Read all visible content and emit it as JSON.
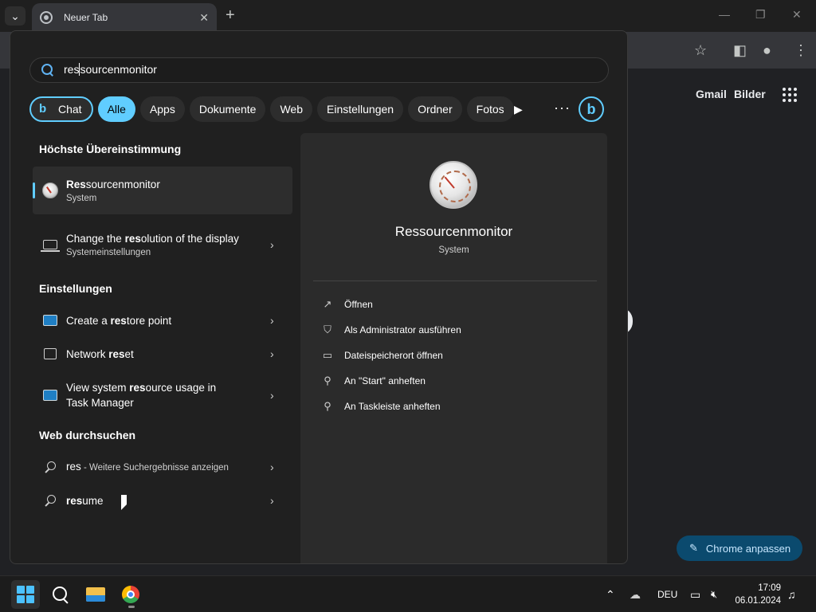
{
  "browser": {
    "tab_title": "Neuer Tab",
    "tab_close": "✕",
    "new_tab": "+",
    "tab_search": "⌄",
    "window_controls": {
      "minimize": "—",
      "maximize": "❐",
      "close": "✕"
    },
    "toolbar_icons": {
      "bookmark": "☆",
      "side_panel": "◧",
      "profile": "●",
      "menu": "⋮"
    },
    "gbar": {
      "gmail": "Gmail",
      "images": "Bilder"
    },
    "customize_button": "Chrome anpassen",
    "customize_icon": "✎"
  },
  "search": {
    "query_prefix": "res",
    "query_rest": "sourcenmonitor",
    "filters": [
      {
        "label": "Chat",
        "icon": "b"
      },
      {
        "label": "Alle",
        "active": true
      },
      {
        "label": "Apps"
      },
      {
        "label": "Dokumente"
      },
      {
        "label": "Web"
      },
      {
        "label": "Einstellungen"
      },
      {
        "label": "Ordner"
      },
      {
        "label": "Fotos"
      }
    ],
    "more_play": "▶",
    "more_dots": "···",
    "bing_icon": "b"
  },
  "results": {
    "best_match_title": "Höchste Übereinstimmung",
    "best_match": [
      {
        "bold": "Res",
        "rest": "sourcenmonitor",
        "pre": "",
        "sub": "System",
        "icon": "resource-monitor-icon"
      },
      {
        "pre": "Change the ",
        "bold": "res",
        "rest": "olution of the display",
        "sub": "Systemeinstellungen",
        "icon": "laptop-icon"
      }
    ],
    "settings_title": "Einstellungen",
    "settings": [
      {
        "pre": "Create a ",
        "bold": "res",
        "rest": "tore point",
        "icon": "monitor-icon"
      },
      {
        "pre": "Network ",
        "bold": "res",
        "rest": "et",
        "icon": "network-icon"
      },
      {
        "pre": "View system ",
        "bold": "res",
        "rest": "ource usage in",
        "line2": "Task Manager",
        "icon": "monitor-icon"
      }
    ],
    "web_title": "Web durchsuchen",
    "web": [
      {
        "main": "res",
        "suffix": " - Weitere Suchergebnisse anzeigen"
      },
      {
        "bold": "res",
        "rest": "ume"
      }
    ],
    "chevron": "›"
  },
  "preview": {
    "title": "Ressourcenmonitor",
    "subtitle": "System",
    "actions": [
      {
        "label": "Öffnen",
        "icon": "↗"
      },
      {
        "label": "Als Administrator ausführen",
        "icon": "⛉"
      },
      {
        "label": "Dateispeicherort öffnen",
        "icon": "▭"
      },
      {
        "label": "An \"Start\" anheften",
        "icon": "⚲"
      },
      {
        "label": "An Taskleiste anheften",
        "icon": "⚲"
      }
    ]
  },
  "taskbar": {
    "tray_chevron": "⌃",
    "language": "DEU",
    "time": "17:09",
    "date": "06.01.2024",
    "notification_icon": "🔔"
  },
  "colors": {
    "accent": "#60cdff",
    "flyout_bg": "#202020",
    "preview_bg": "#2b2b2b",
    "customize_bg": "#0b4a6e"
  }
}
